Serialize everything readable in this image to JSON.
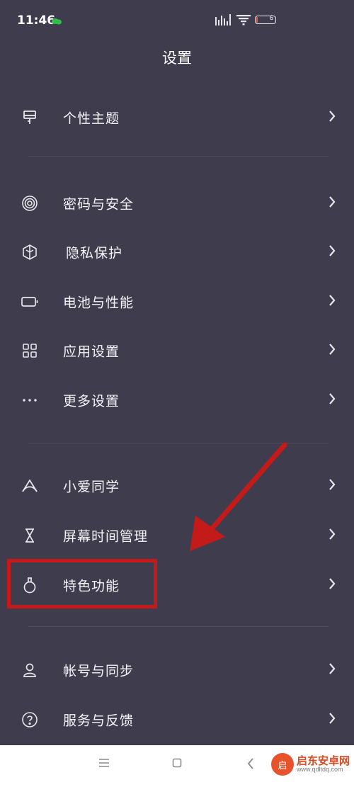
{
  "status_bar": {
    "time": "11:46",
    "battery_text": "6",
    "battery_level": 0.06
  },
  "header": {
    "title": "设置"
  },
  "settings": [
    {
      "label": "个性主题",
      "icon": "brush-icon"
    },
    {
      "label": "密码与安全",
      "icon": "fingerprint-icon"
    },
    {
      "label": "隐私保护",
      "icon": "privacy-icon"
    },
    {
      "label": "电池与性能",
      "icon": "battery-icon"
    },
    {
      "label": "应用设置",
      "icon": "apps-grid-icon"
    },
    {
      "label": "更多设置",
      "icon": "more-dots-icon"
    },
    {
      "label": "小爱同学",
      "icon": "assistant-icon"
    },
    {
      "label": "屏幕时间管理",
      "icon": "hourglass-icon"
    },
    {
      "label": "特色功能",
      "icon": "flask-icon"
    },
    {
      "label": "帐号与同步",
      "icon": "account-icon"
    },
    {
      "label": "服务与反馈",
      "icon": "help-icon"
    }
  ],
  "watermark": {
    "badge": "启",
    "text": "启东安卓网",
    "url": "www.qdltdq.com"
  },
  "colors": {
    "background": "#3f3d4d",
    "annotation": "#c41a1a",
    "nav_bar": "#ffffff"
  }
}
